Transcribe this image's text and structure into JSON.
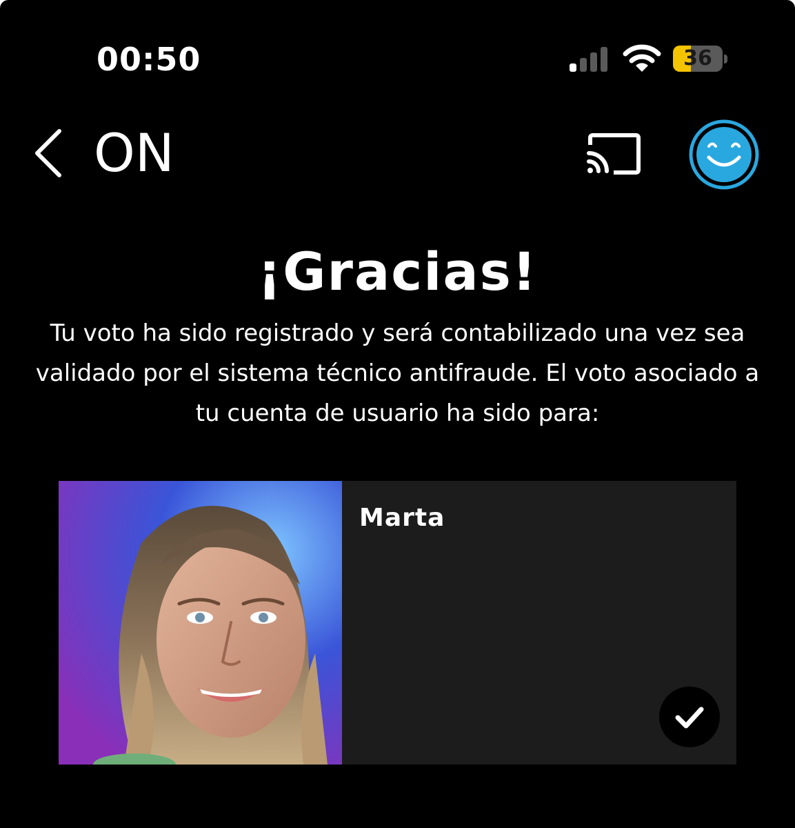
{
  "status_bar": {
    "time": "00:50",
    "battery_level": "36",
    "battery_fraction": 0.36,
    "signal_icon": "signal-bars-icon",
    "wifi_icon": "wifi-icon"
  },
  "nav": {
    "back_icon": "chevron-left-icon",
    "title": "ON",
    "cast_icon": "cast-icon",
    "profile_icon": "smiley-face-icon"
  },
  "content": {
    "heading": "¡Gracias!",
    "message": "Tu voto ha sido registrado y será contabilizado una vez sea validado por el sistema técnico antifraude. El voto asociado a tu cuenta de usuario ha sido para:"
  },
  "candidate": {
    "name": "Marta",
    "selected": true,
    "check_icon": "checkmark-icon"
  },
  "colors": {
    "background": "#000000",
    "card_background": "#1c1c1c",
    "profile_accent": "#29a8e0",
    "battery_low_power": "#f5c400"
  }
}
